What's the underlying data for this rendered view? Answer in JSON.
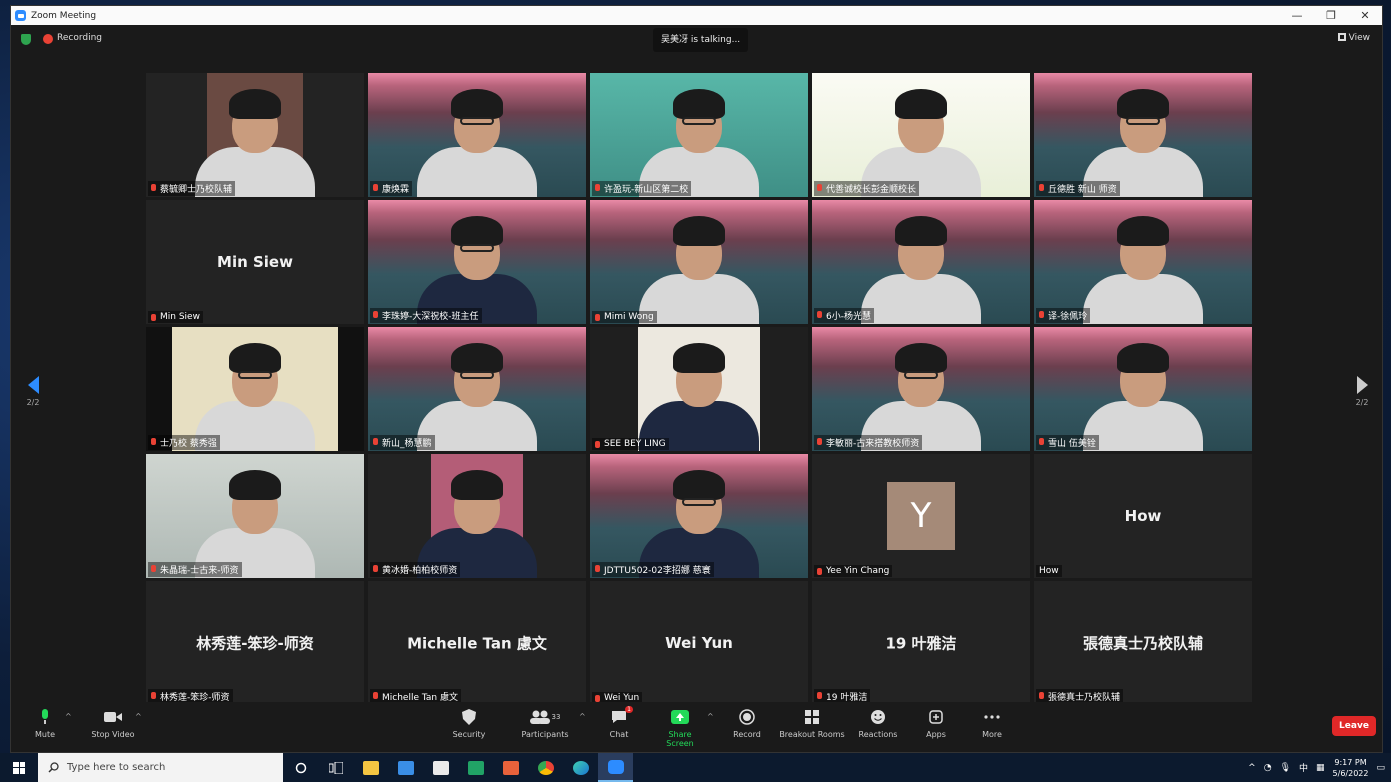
{
  "window": {
    "title": "Zoom Meeting",
    "minimize": "—",
    "maximize": "❐",
    "close": "✕"
  },
  "topbar": {
    "recording": "Recording",
    "talking": "吴美冴 is talking...",
    "view": "View"
  },
  "nav": {
    "page_left": "2/2",
    "page_right": "2/2"
  },
  "tiles": [
    {
      "name": "蔡毓卿士乃校队辅",
      "type": "video",
      "style": "grey"
    },
    {
      "name": "康焕霖",
      "type": "video",
      "style": "pink"
    },
    {
      "name": "许盈玩-新山区第二校",
      "type": "video",
      "style": "teal"
    },
    {
      "name": "代善诚校长彭金顺校长",
      "type": "video",
      "style": "cartoon"
    },
    {
      "name": "丘德胜 新山 师资",
      "type": "video",
      "style": "pink"
    },
    {
      "name": "Min Siew",
      "big": "Min Siew",
      "type": "name"
    },
    {
      "name": "李珠婷-大深祝校-班主任",
      "type": "video",
      "style": "pink"
    },
    {
      "name": "Mimi Wong",
      "type": "video",
      "style": "pink"
    },
    {
      "name": "6小-杨光慧",
      "type": "video",
      "style": "pink"
    },
    {
      "name": "译-徐佩玲",
      "type": "video",
      "style": "pink"
    },
    {
      "name": "士乃校 蔡秀强",
      "type": "video",
      "style": "room"
    },
    {
      "name": "新山_杨慧鹏",
      "type": "video",
      "style": "pink"
    },
    {
      "name": "SEE BEY LING",
      "type": "video",
      "style": "office"
    },
    {
      "name": "李敏丽-古来搭教校师资",
      "type": "video",
      "style": "pink"
    },
    {
      "name": "雪山 伍美铨",
      "type": "video",
      "style": "pink"
    },
    {
      "name": "朱晶瑞-士古来-师资",
      "type": "video",
      "style": "room2"
    },
    {
      "name": "黄冰婚-柏柏校师资",
      "type": "video",
      "style": "poster"
    },
    {
      "name": "JDTTU502-02李招娜 慈寰",
      "type": "video",
      "style": "pink"
    },
    {
      "name": "Yee Yin Chang",
      "avatar": "Y",
      "type": "avatar"
    },
    {
      "name": "How",
      "big": "How",
      "type": "name",
      "plain": true
    },
    {
      "name": "林秀莲-笨珍-师资",
      "big": "林秀莲-笨珍-师资",
      "type": "name"
    },
    {
      "name": "Michelle Tan 慮文",
      "big": "Michelle Tan 慮文",
      "type": "name"
    },
    {
      "name": "Wei Yun",
      "big": "Wei Yun",
      "type": "name"
    },
    {
      "name": "19 叶雅洁",
      "big": "19 叶雅洁",
      "type": "name"
    },
    {
      "name": "張德真士乃校队辅",
      "big": "張德真士乃校队辅",
      "type": "name"
    }
  ],
  "toolbar": {
    "mute": "Mute",
    "stop_video": "Stop Video",
    "security": "Security",
    "participants": "Participants",
    "participants_count": "33",
    "chat": "Chat",
    "chat_badge": "1",
    "share_screen": "Share Screen",
    "record": "Record",
    "breakout": "Breakout Rooms",
    "reactions": "Reactions",
    "apps": "Apps",
    "more": "More",
    "leave": "Leave"
  },
  "taskbar": {
    "search_placeholder": "Type here to search",
    "time": "9:17 PM",
    "date": "5/6/2022",
    "lang": "中"
  },
  "colors": {
    "zoom_blue": "#2d8cff",
    "leave_red": "#e02828",
    "share_green": "#23d959"
  }
}
